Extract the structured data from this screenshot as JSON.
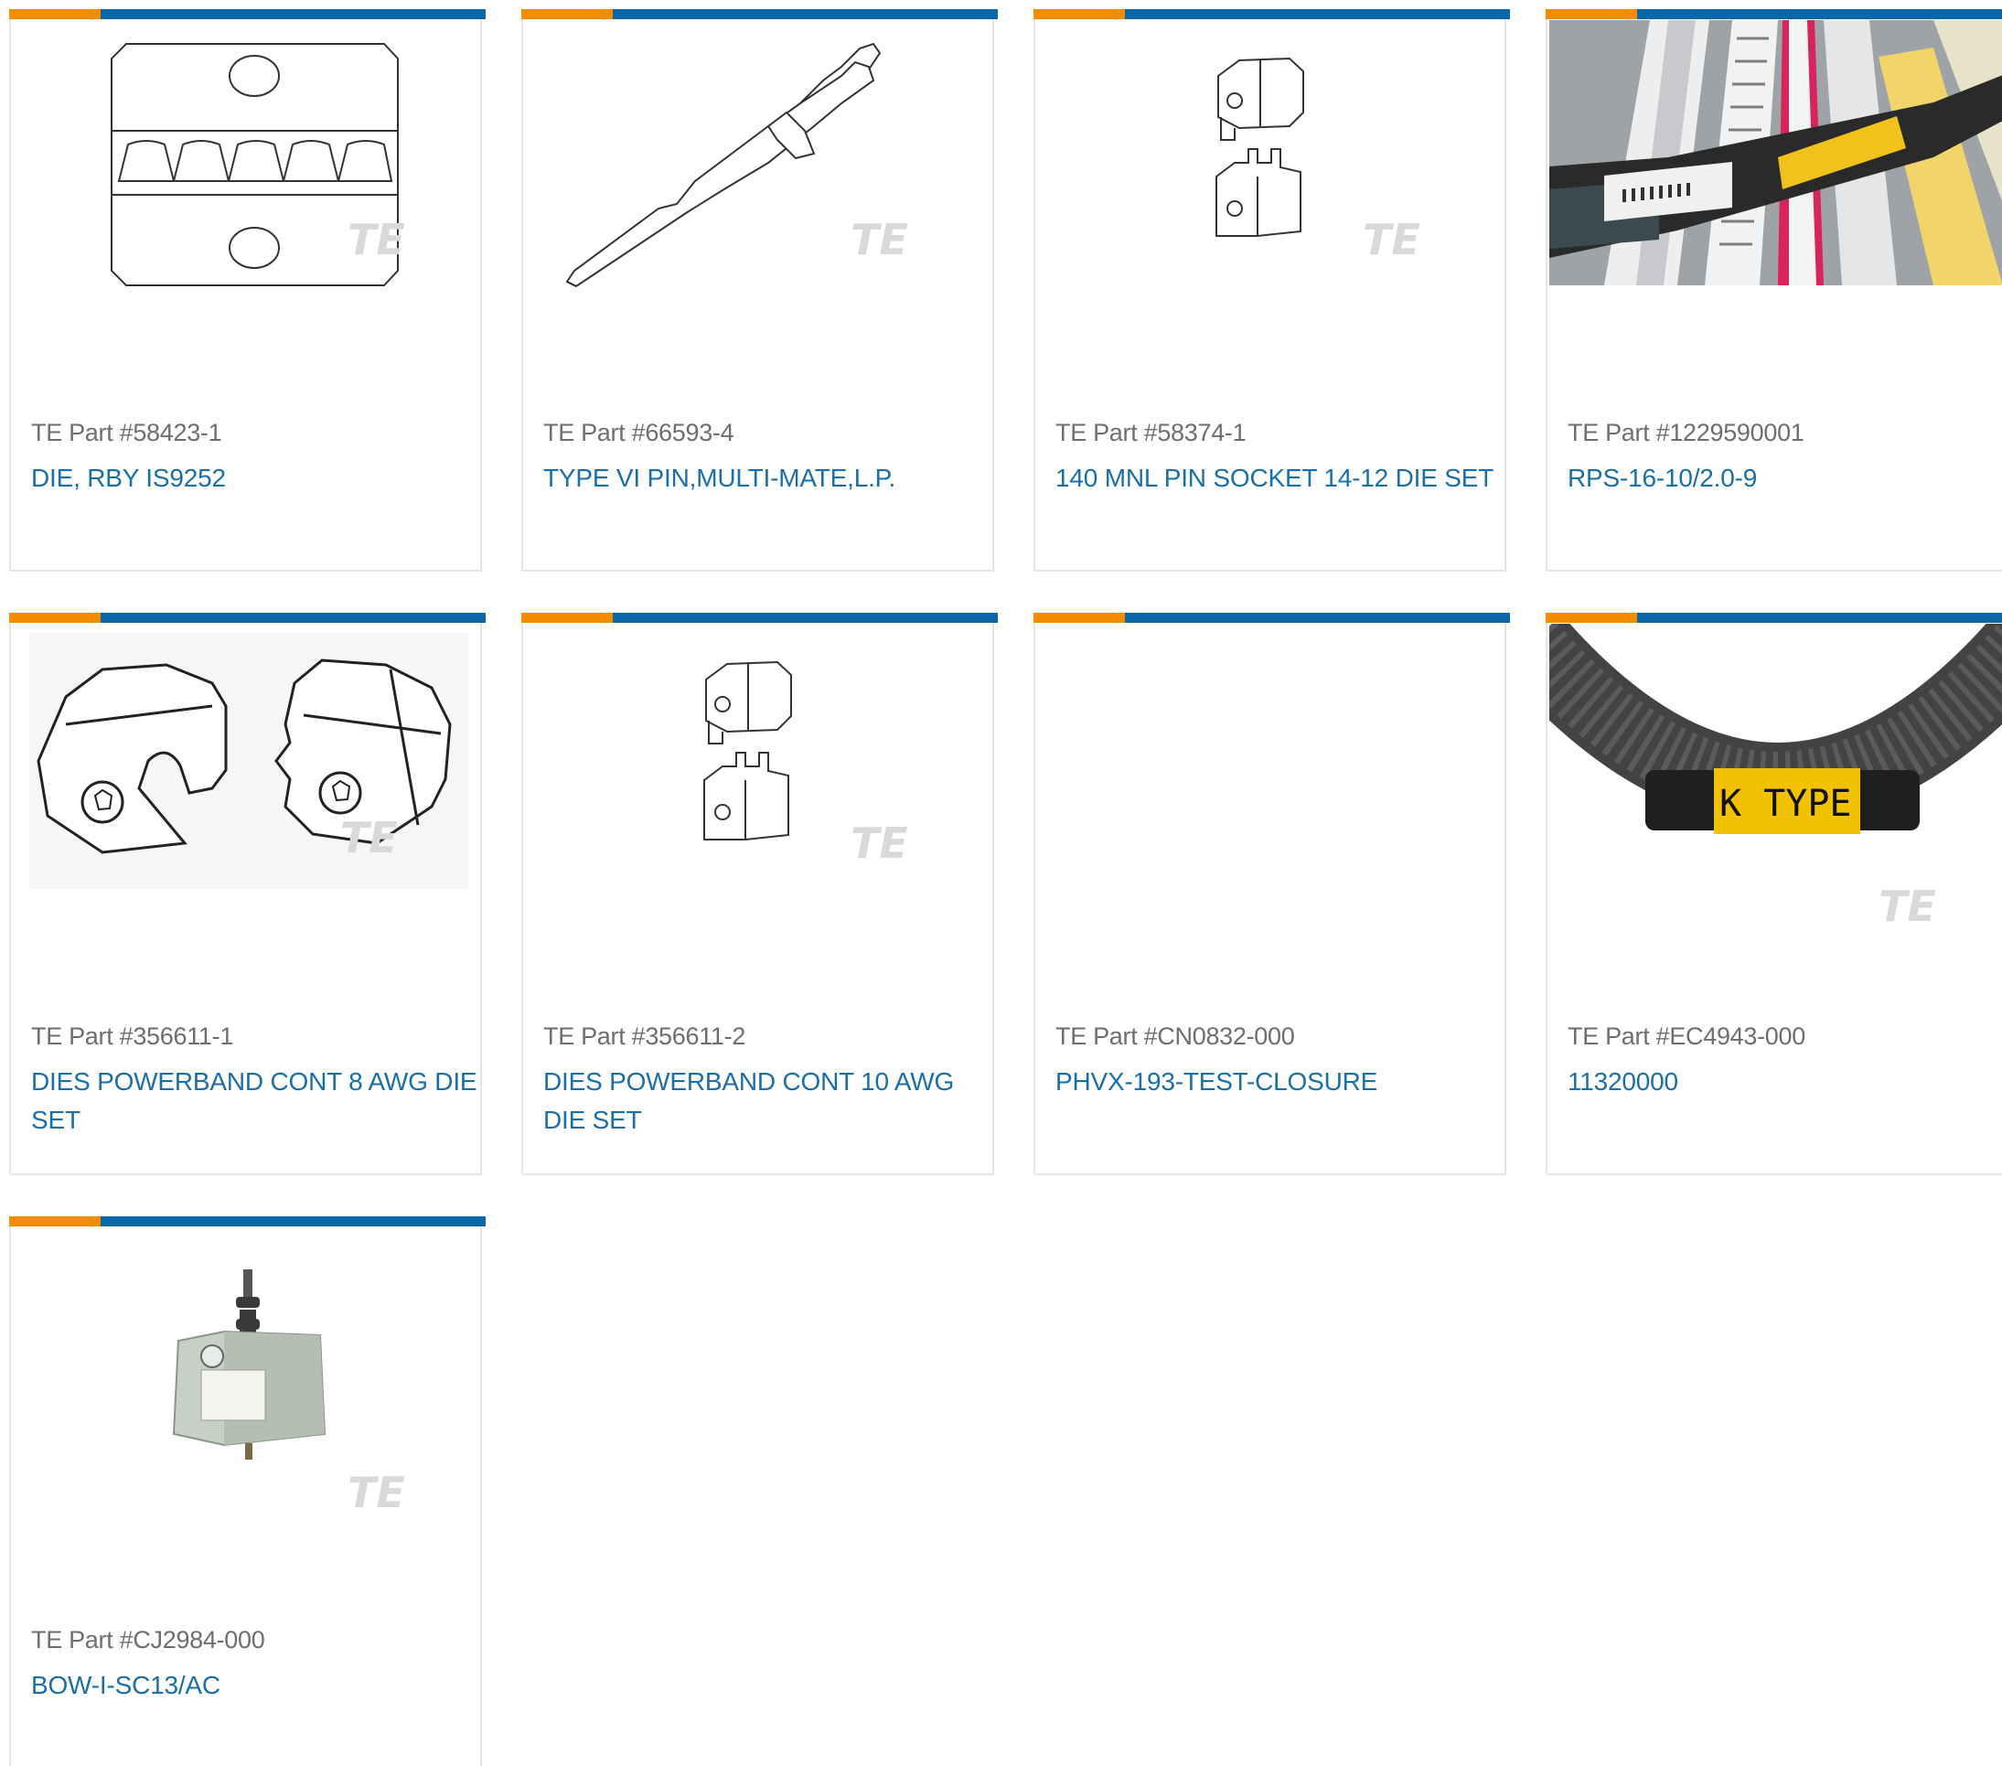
{
  "cards": [
    {
      "part": "TE Part #58423-1",
      "desc": "DIE, RBY IS9252",
      "image": "crimp-die-image"
    },
    {
      "part": "TE Part #66593-4",
      "desc": "TYPE VI PIN,MULTI-MATE,L.P.",
      "image": "contact-pin-image"
    },
    {
      "part": "TE Part #58374-1",
      "desc": "140 MNL PIN SOCKET 14-12 DIE SET",
      "image": "die-set-image"
    },
    {
      "part": "TE Part #1229590001",
      "desc": "RPS-16-10/2.0-9",
      "image": "marker-sleeves-photo"
    },
    {
      "part": "TE Part #356611-1",
      "desc": "DIES POWERBAND CONT 8 AWG DIE SET",
      "image": "powerband-die-image"
    },
    {
      "part": "TE Part #356611-2",
      "desc": "DIES POWERBAND CONT 10 AWG DIE SET",
      "image": "die-set-image"
    },
    {
      "part": "TE Part #CN0832-000",
      "desc": "PHVX-193-TEST-CLOSURE",
      "image": "none"
    },
    {
      "part": "TE Part #EC4943-000",
      "desc": "11320000",
      "image": "conduit-marker-photo"
    },
    {
      "part": "TE Part #CJ2984-000",
      "desc": "BOW-I-SC13/AC",
      "image": "arrester-photo"
    }
  ],
  "watermark": "TE",
  "conduit_marker_text": "K TYPE",
  "colors": {
    "accent_orange": "#f28c00",
    "accent_blue": "#0b67a7",
    "link_blue": "#1a6fa8",
    "label_gray": "#6e6e6e"
  }
}
